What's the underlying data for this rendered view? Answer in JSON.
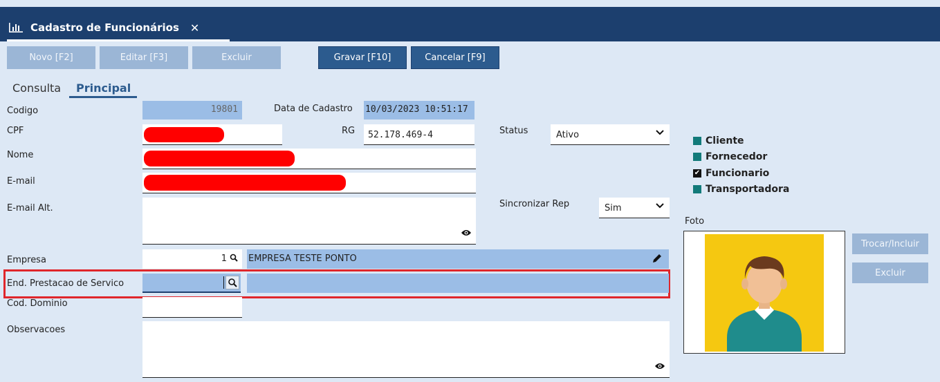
{
  "window": {
    "tab_title": "Cadastro de Funcionários",
    "close_glyph": "✕"
  },
  "toolbar": {
    "novo": "Novo [F2]",
    "editar": "Editar [F3]",
    "excluir": "Excluir",
    "gravar": "Gravar [F10]",
    "cancelar": "Cancelar [F9]"
  },
  "tabs": {
    "consulta": "Consulta",
    "principal": "Principal"
  },
  "form": {
    "codigo_label": "Codigo",
    "codigo_value": "19801",
    "data_cadastro_label": "Data de Cadastro",
    "data_cadastro_value": "10/03/2023 10:51:17",
    "cpf_label": "CPF",
    "rg_label": "RG",
    "rg_value": "52.178.469-4",
    "status_label": "Status",
    "status_value": "Ativo",
    "nome_label": "Nome",
    "email_label": "E-mail",
    "email_alt_label": "E-mail Alt.",
    "sincronizar_label": "Sincronizar Rep",
    "sincronizar_value": "Sim",
    "empresa_label": "Empresa",
    "empresa_code": "1",
    "empresa_name": "EMPRESA TESTE PONTO",
    "end_prestacao_label": "End. Prestacao de Servico",
    "cod_dominio_label": "Cod. Dominio",
    "observacoes_label": "Observacoes"
  },
  "types": {
    "cliente": "Cliente",
    "fornecedor": "Fornecedor",
    "funcionario": "Funcionario",
    "transportadora": "Transportadora",
    "funcionario_checked": true
  },
  "photo": {
    "label": "Foto",
    "trocar": "Trocar/Incluir",
    "excluir": "Excluir"
  },
  "colors": {
    "titlebar": "#1c3f6e",
    "accent": "#2c5b8e",
    "disabled_button": "#9bb6d6",
    "readonly_field": "#9bbde6",
    "highlight": "#e0262b",
    "photo_bg": "#f5c811"
  }
}
